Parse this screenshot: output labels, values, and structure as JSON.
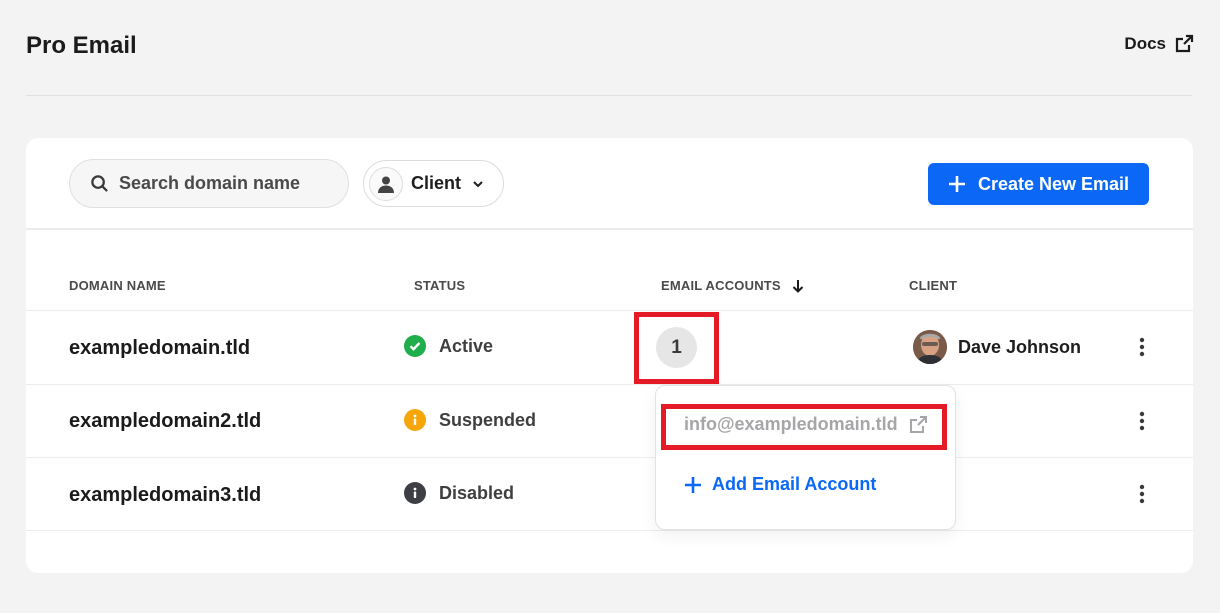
{
  "page": {
    "title": "Pro Email",
    "docs_label": "Docs"
  },
  "toolbar": {
    "search_placeholder": "Search domain name",
    "client_filter_label": "Client",
    "create_button_label": "Create New Email"
  },
  "table": {
    "columns": [
      "DOMAIN NAME",
      "STATUS",
      "EMAIL ACCOUNTS",
      "CLIENT"
    ],
    "sort_indicator": "arrow-down-icon",
    "rows": [
      {
        "domain": "exampledomain.tld",
        "status": "Active",
        "status_color": "#1fae4b",
        "status_icon": "check-circle-icon",
        "email_count": "1",
        "client": "Dave Johnson"
      },
      {
        "domain": "exampledomain2.tld",
        "status": "Suspended",
        "status_color": "#f6a609",
        "status_icon": "info-circle-icon",
        "email_count": "",
        "client": ""
      },
      {
        "domain": "exampledomain3.tld",
        "status": "Disabled",
        "status_color": "#3d3f45",
        "status_icon": "info-circle-icon",
        "email_count": "",
        "client": ""
      }
    ]
  },
  "popover": {
    "email": "info@exampledomain.tld",
    "add_label": "Add Email Account"
  },
  "colors": {
    "accent": "#0b68f7",
    "highlight": "#e41a26",
    "background": "#f3f3f4"
  }
}
